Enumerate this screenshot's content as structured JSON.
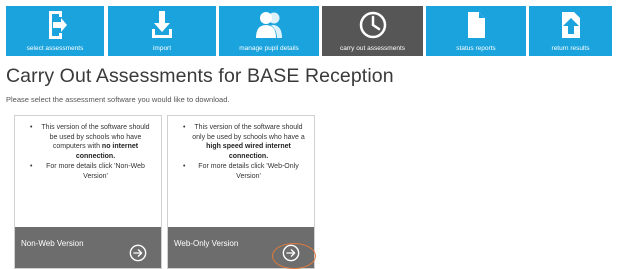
{
  "nav": {
    "items": [
      {
        "label": "select assessments",
        "icon": "select-assessments-icon"
      },
      {
        "label": "import",
        "icon": "download-icon"
      },
      {
        "label": "manage pupil details",
        "icon": "users-icon"
      },
      {
        "label": "carry out assessments",
        "icon": "clock-icon"
      },
      {
        "label": "status reports",
        "icon": "document-icon"
      },
      {
        "label": "return results",
        "icon": "upload-icon"
      }
    ],
    "active_index": 3,
    "colors": {
      "tile": "#1aa3dd",
      "active": "#565656"
    }
  },
  "page": {
    "title": "Carry Out Assessments for BASE Reception",
    "subtitle": "Please select the assessment software you would like to download."
  },
  "cards": [
    {
      "bullets": [
        {
          "pre": "This version of the software should be used by schools who have computers with ",
          "bold": "no internet connection.",
          "post": ""
        },
        {
          "pre": "For more details click 'Non-Web Version'",
          "bold": "",
          "post": ""
        }
      ],
      "footer_label": "Non-Web Version"
    },
    {
      "bullets": [
        {
          "pre": "This version of the software should only be used by schools who have a ",
          "bold": "high speed wired internet connection.",
          "post": ""
        },
        {
          "pre": "For more details click 'Web-Only Version'",
          "bold": "",
          "post": ""
        }
      ],
      "footer_label": "Web-Only Version"
    }
  ]
}
